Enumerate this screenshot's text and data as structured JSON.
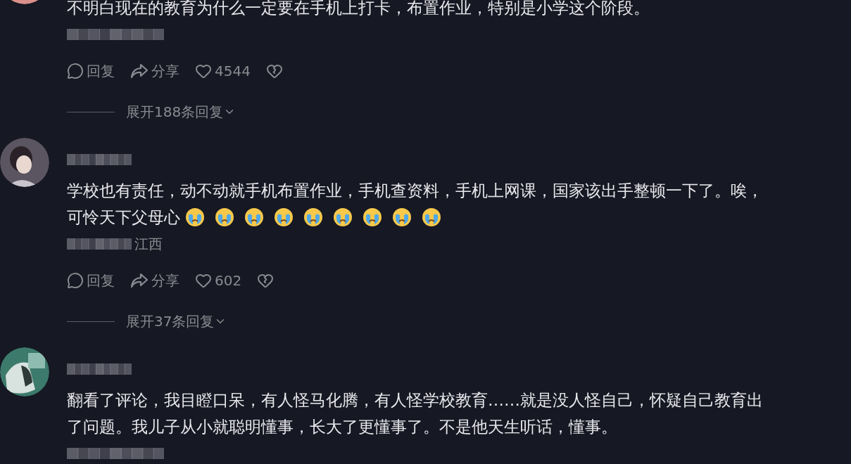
{
  "comments": [
    {
      "lines": [
        [
          {
            "kind": "text",
            "text": "不明白现在的教育为什么一定要在手机上打卡，布置作业，特别是小学这个阶段。"
          }
        ]
      ],
      "reply": "回复",
      "share": "分享",
      "likes": "4544",
      "expand": "展开188条回复"
    },
    {
      "lines": [
        [
          {
            "kind": "text",
            "text": "学校也有责任，动不动就手机布置作业，手机查资料，手机上网课，国家该出手整顿一下了。唉，"
          }
        ],
        [
          {
            "kind": "text",
            "text": "可怜天下父母心"
          },
          {
            "kind": "emoji"
          },
          {
            "kind": "emoji"
          },
          {
            "kind": "emoji"
          },
          {
            "kind": "emoji"
          },
          {
            "kind": "emoji"
          },
          {
            "kind": "emoji"
          },
          {
            "kind": "emoji"
          },
          {
            "kind": "emoji"
          },
          {
            "kind": "emoji"
          }
        ]
      ],
      "location": "江西",
      "reply": "回复",
      "share": "分享",
      "likes": "602",
      "expand": "展开37条回复"
    },
    {
      "lines": [
        [
          {
            "kind": "text",
            "text": "翻看了评论，我目瞪口呆，有人怪马化腾，有人怪学校教育……就是没人怪自己，怀疑自己教育出"
          }
        ],
        [
          {
            "kind": "text",
            "text": "了问题。我儿子从小就聪明懂事，长大了更懂事了。不是他天生听话，懂事。"
          }
        ]
      ]
    }
  ]
}
